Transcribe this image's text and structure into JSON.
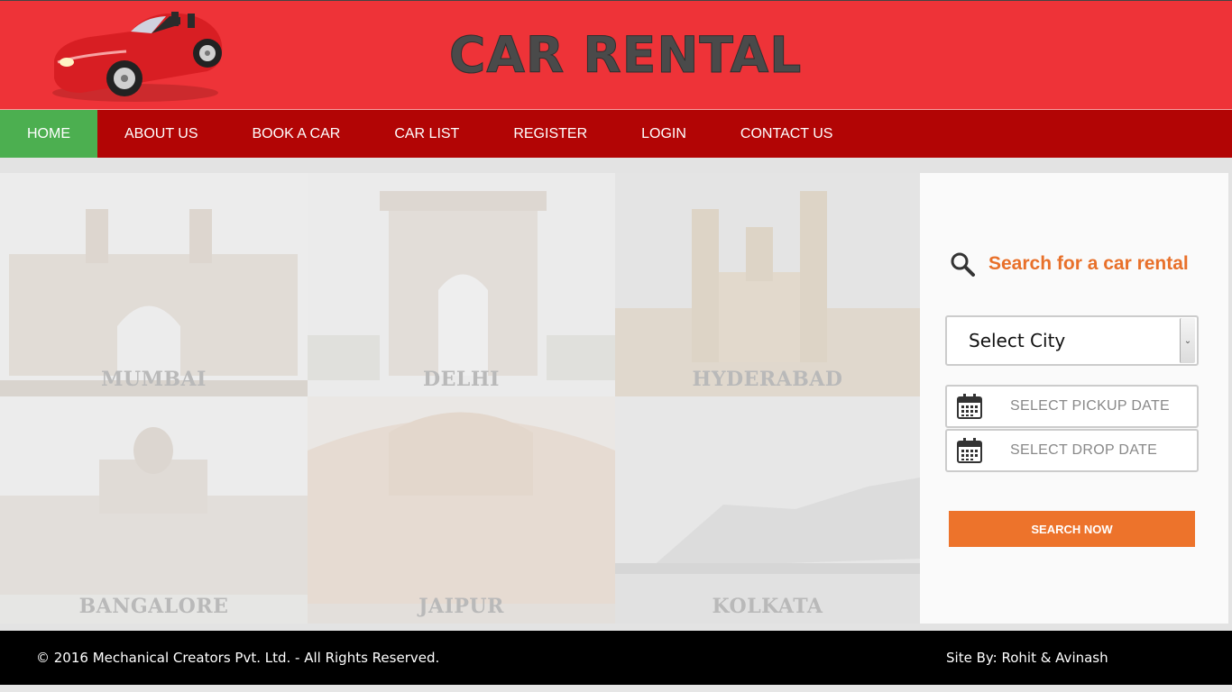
{
  "header": {
    "title": "CAR RENTAL",
    "logo_icon": "red-convertible-car-icon",
    "colors": {
      "background": "#ee3338",
      "title": "#4a4a4a"
    }
  },
  "nav": {
    "items": [
      {
        "label": "HOME",
        "active": true
      },
      {
        "label": "ABOUT US"
      },
      {
        "label": "BOOK A CAR"
      },
      {
        "label": "CAR LIST"
      },
      {
        "label": "REGISTER"
      },
      {
        "label": "LOGIN"
      },
      {
        "label": "CONTACT US"
      }
    ],
    "colors": {
      "background": "#b20505",
      "active": "#4caf50"
    }
  },
  "cities": [
    "MUMBAI",
    "DELHI",
    "HYDERABAD",
    "BANGALORE",
    "JAIPUR",
    "KOLKATA"
  ],
  "search": {
    "heading": "Search for a car rental",
    "heading_icon": "search-icon",
    "city_select_value": "Select City",
    "pickup_placeholder": "SELECT PICKUP DATE",
    "drop_placeholder": "SELECT DROP DATE",
    "date_icon": "calendar-icon",
    "button_label": "SEARCH NOW",
    "colors": {
      "accent": "#ed732b"
    }
  },
  "footer": {
    "copyright": "© 2016 Mechanical Creators Pvt. Ltd. - All Rights Reserved.",
    "site_by": "Site By: Rohit & Avinash"
  }
}
